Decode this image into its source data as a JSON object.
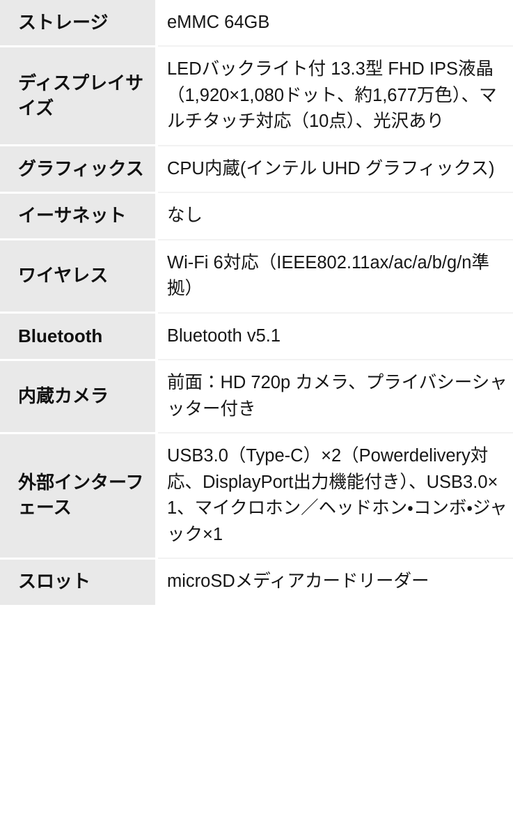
{
  "table": {
    "type": "spec-table",
    "columns": 2,
    "colors": {
      "label_background": "#e9e9e9",
      "value_background": "#ffffff",
      "text": "#161616",
      "divider": "#f2f2f2"
    },
    "rows": [
      {
        "label": "ストレージ",
        "value": "eMMC 64GB"
      },
      {
        "label": "ディスプレイサイズ",
        "value": "LEDバックライト付 13.3型 FHD IPS液晶（1,920×1,080ドット、約1,677万色）、マルチタッチ対応（10点）、光沢あり"
      },
      {
        "label": "グラフィックス",
        "value": "CPU内蔵(インテル UHD グラフィックス)"
      },
      {
        "label": "イーサネット",
        "value": "なし"
      },
      {
        "label": "ワイヤレス",
        "value": "Wi-Fi 6対応（IEEE802.11ax/ac/a/b/g/n準拠）"
      },
      {
        "label": "Bluetooth",
        "value": "Bluetooth v5.1"
      },
      {
        "label": "内蔵カメラ",
        "value": "前面：HD 720p カメラ、プライバシーシャッター付き"
      },
      {
        "label": "外部インターフェース",
        "value": "USB3.0（Type-C）×2（Powerdelivery対応、DisplayPort出力機能付き）、USB3.0×1、マイクロホン／ヘッドホン・コンボ・ジャック×1"
      },
      {
        "label": "スロット",
        "value": "microSDメディアカードリーダー"
      }
    ]
  }
}
